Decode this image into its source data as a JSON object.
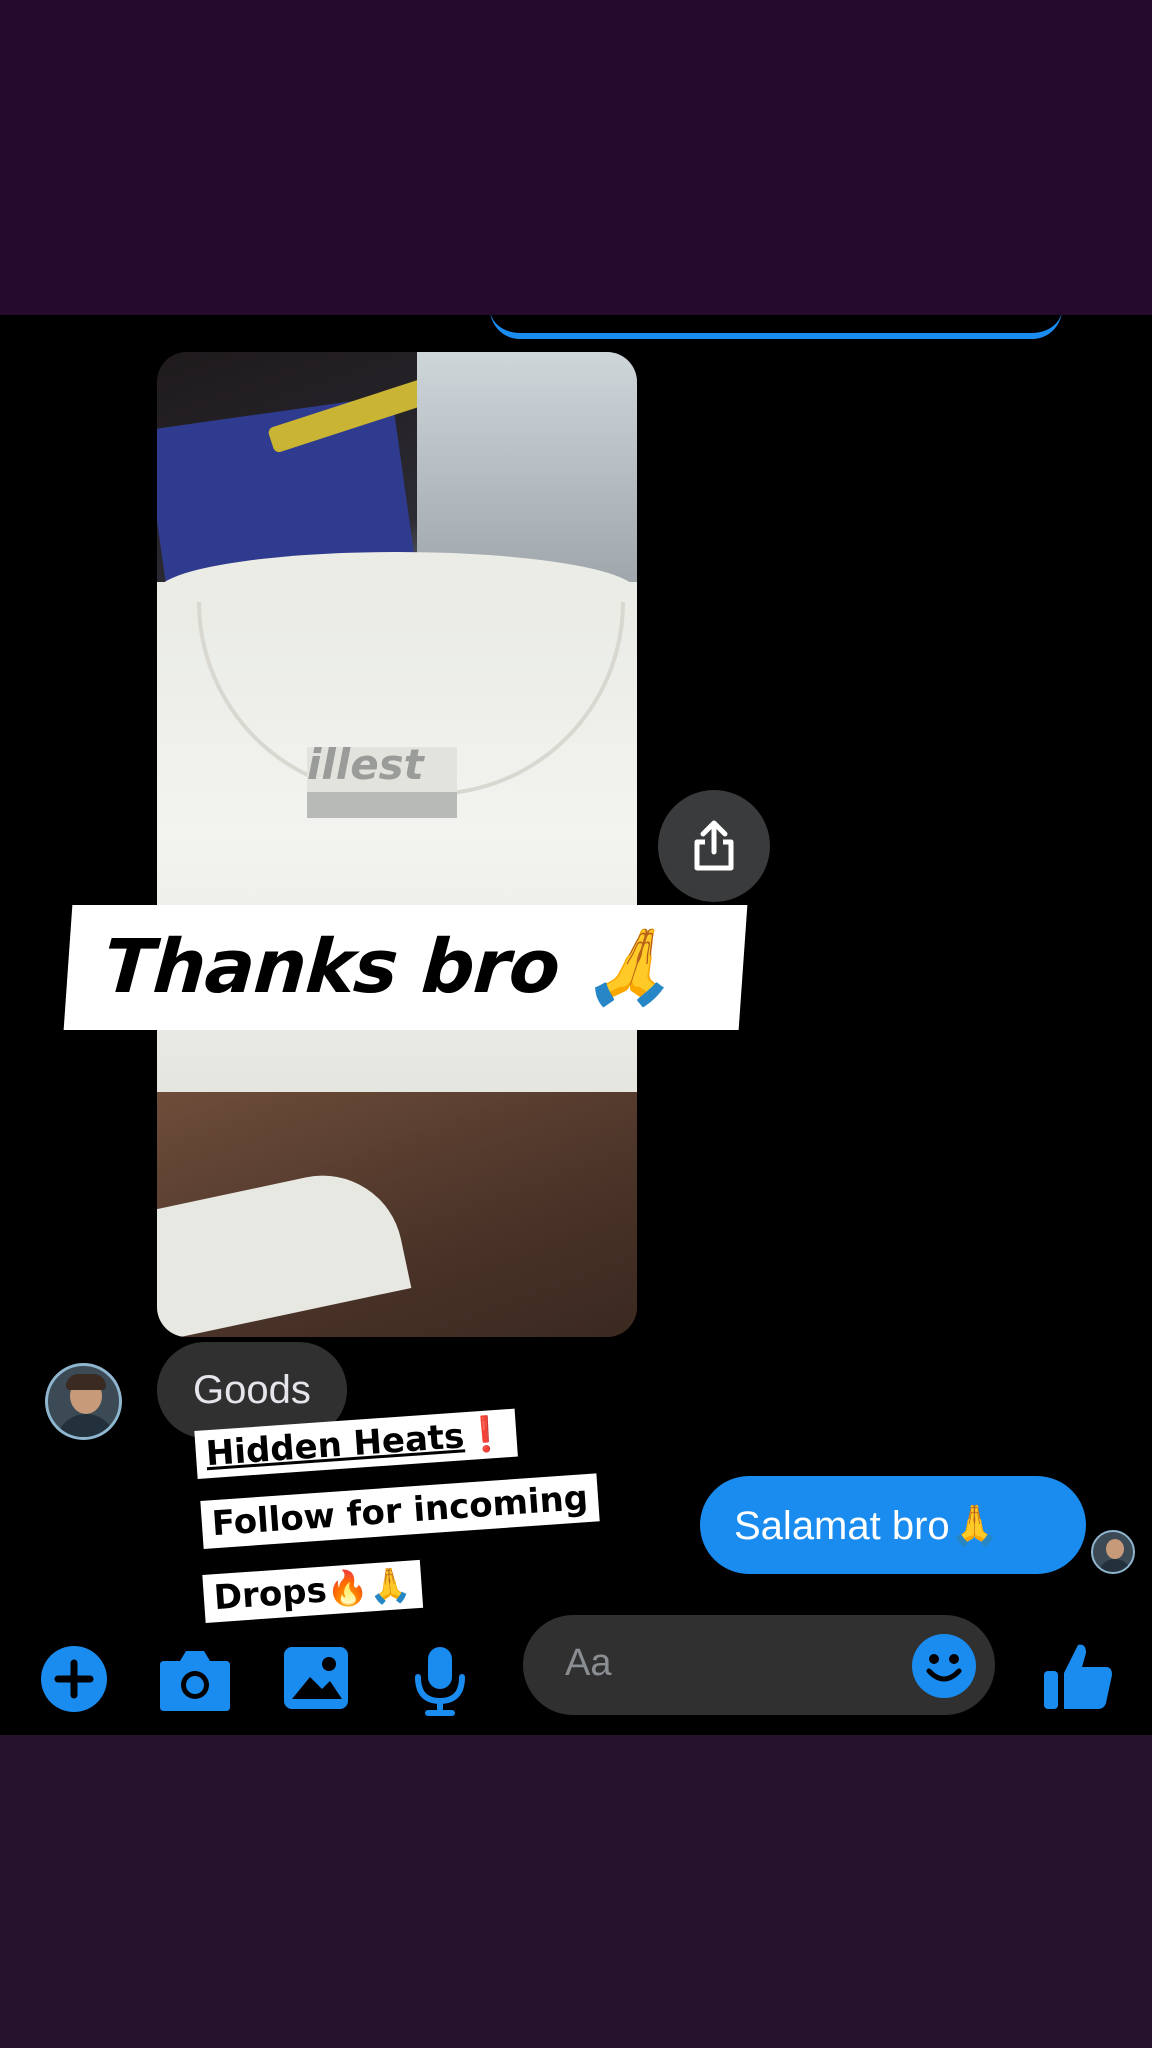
{
  "sticker_caption": "Thanks bro 🙏",
  "messages": {
    "received": "Goods",
    "sent": "Salamat bro🙏"
  },
  "promo": {
    "line1": "Hidden Heats",
    "line1_mark": "❗",
    "line2": "Follow for incoming",
    "line3": "Drops🔥🙏"
  },
  "composer": {
    "placeholder": "Aa",
    "icons": [
      "plus-circle-icon",
      "camera-icon",
      "gallery-icon",
      "microphone-icon",
      "emoji-icon",
      "thumbs-up-icon"
    ]
  },
  "photo": {
    "tag_text": "illest"
  },
  "colors": {
    "accent": "#1a8cf0",
    "chat_background": "#000000",
    "received_bubble": "#303030",
    "frame_top": "#260a2c",
    "frame_bottom": "#26122d"
  }
}
